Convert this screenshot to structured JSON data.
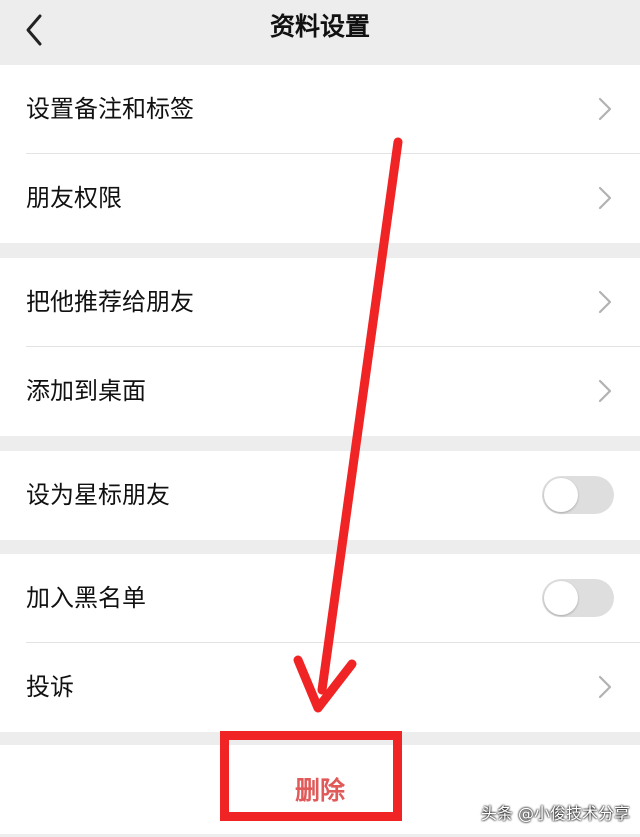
{
  "nav": {
    "title": "资料设置",
    "back_icon": "chevron-left-icon"
  },
  "groups": [
    {
      "items": [
        {
          "label": "设置备注和标签",
          "control": "chevron"
        },
        {
          "label": "朋友权限",
          "control": "chevron"
        }
      ]
    },
    {
      "items": [
        {
          "label": "把他推荐给朋友",
          "control": "chevron"
        },
        {
          "label": "添加到桌面",
          "control": "chevron"
        }
      ]
    },
    {
      "items": [
        {
          "label": "设为星标朋友",
          "control": "toggle",
          "on": false
        }
      ]
    },
    {
      "items": [
        {
          "label": "加入黑名单",
          "control": "toggle",
          "on": false
        },
        {
          "label": "投诉",
          "control": "chevron"
        }
      ]
    }
  ],
  "delete": {
    "label": "删除"
  },
  "annotation": {
    "color": "#f02424"
  },
  "watermark": "头条 @小俊技术分享",
  "colors": {
    "background": "#ededed",
    "delete_text": "#e05a5a",
    "toggle_off": "#dedede"
  }
}
